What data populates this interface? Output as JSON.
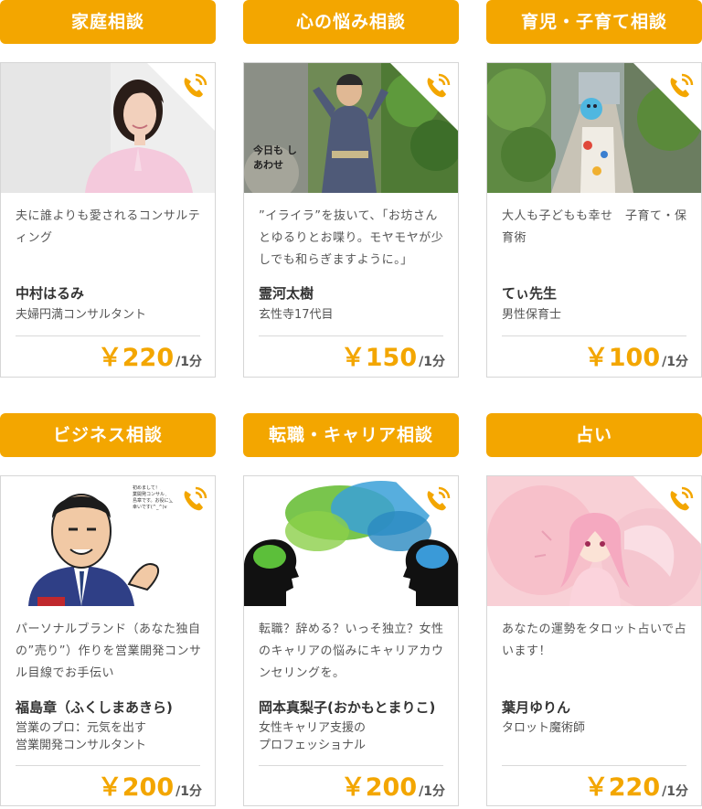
{
  "colors": {
    "accent": "#f3a600",
    "card_border": "#d6d6d6",
    "text": "#333333"
  },
  "cards": [
    {
      "category": "家庭相談",
      "desc": "夫に誰よりも愛されるコンサルティング",
      "name": "中村はるみ",
      "title": "夫婦円満コンサルタント",
      "price": "￥220",
      "unit": "/1分"
    },
    {
      "category": "心の悩み相談",
      "desc": "”イライラ”を抜いて、「お坊さんとゆるりとお喋り。モヤモヤが少しでも和らぎますように。」",
      "name": "霊河太樹",
      "title": "玄性寺17代目",
      "price": "￥150",
      "unit": "/1分"
    },
    {
      "category": "育児・子育て相談",
      "desc": "大人も子どもも幸せ　子育て・保育術",
      "name": "てぃ先生",
      "title": "男性保育士",
      "price": "￥100",
      "unit": "/1分"
    },
    {
      "category": "ビジネス相談",
      "desc": "パーソナルブランド（あなた独自の”売り”）作りを営業開発コンサル目線でお手伝い",
      "name": "福島章（ふくしまあきら)",
      "title_lines": [
        "営業のプロ：元気を出す",
        "営業開発コンサルタント"
      ],
      "price": "￥200",
      "unit": "/1分"
    },
    {
      "category": "転職・キャリア相談",
      "desc": "転職？辞める？いっそ独立？女性のキャリアの悩みにキャリアカウンセリングを。",
      "name": "岡本真梨子(おかもとまりこ)",
      "title_lines": [
        "女性キャリア支援の",
        "プロフェッショナル"
      ],
      "price": "￥200",
      "unit": "/1分"
    },
    {
      "category": "占い",
      "desc": "あなたの運勢をタロット占いで占います！",
      "name": "葉月ゆりん",
      "title": "タロット魔術師",
      "price": "￥220",
      "unit": "/1分"
    }
  ],
  "icons": {
    "call": "phone-call-icon"
  },
  "photo_texts": {
    "card2_calligraphy": "今日も しあわせ",
    "card4_speech": "初めまして！元気を出す営業開発コンサルタントの福島章です。お役に立てれば幸いです(^_^)v"
  }
}
